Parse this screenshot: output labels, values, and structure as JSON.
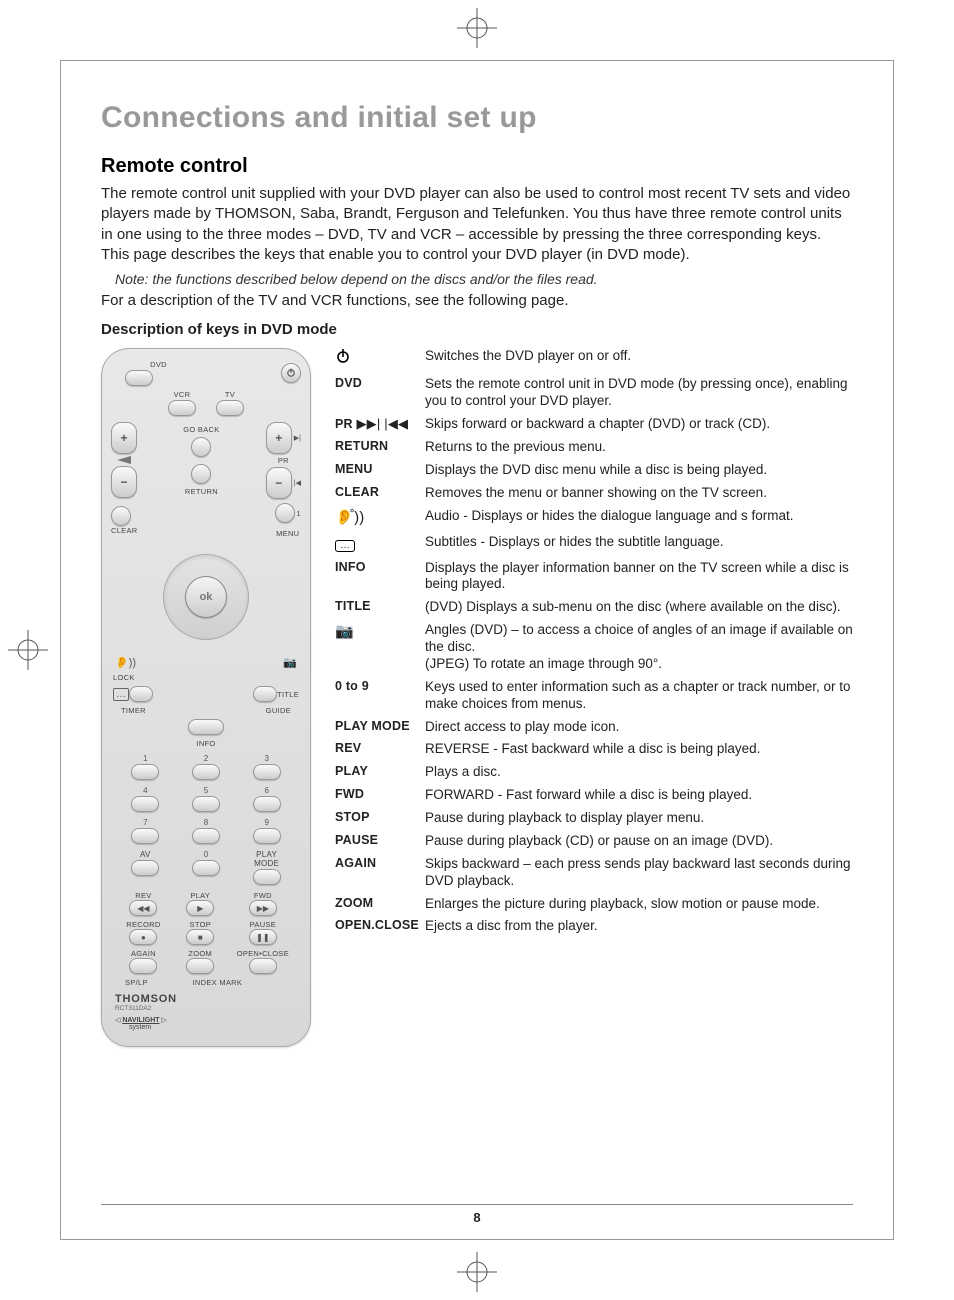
{
  "section_title": "Connections and initial set up",
  "subheading": "Remote control",
  "intro_paragraph": "The remote control unit supplied with your DVD player can also be used to control most recent TV sets and video players made by THOMSON, Saba, Brandt, Ferguson and Telefunken. You thus have three remote control units in one using to the three modes – DVD, TV and VCR – accessible by pressing the three corresponding keys. This page describes the keys that enable you to control your DVD player (in DVD mode).",
  "note": "Note: the functions described below depend on the discs and/or the files read.",
  "followup": "For a description of the TV and VCR functions, see the following page.",
  "desc_heading": "Description of keys in DVD mode",
  "page_number": "8",
  "remote": {
    "top_label_dvd": "DVD",
    "vcr": "VCR",
    "tv": "TV",
    "go_back": "GO BACK",
    "return": "RETURN",
    "pr": "PR",
    "clear": "CLEAR",
    "menu": "MENU",
    "ok": "ok",
    "digit1": "1",
    "lock": "LOCK",
    "title": "TITLE",
    "timer": "TIMER",
    "guide": "GUIDE",
    "info": "INFO",
    "av": "AV",
    "zero": "0",
    "play_mode": "PLAY MODE",
    "rev": "REV",
    "play": "PLAY",
    "fwd": "FWD",
    "record": "RECORD",
    "stop": "STOP",
    "pause": "PAUSE",
    "again": "AGAIN",
    "zoom": "ZOOM",
    "open_close": "OPEN•CLOSE",
    "sp_lp": "SP/LP",
    "index_mark": "INDEX MARK",
    "brand": "THOMSON",
    "model": "RCT311DA2",
    "navilight": "NAVILIGHT",
    "navisystem": "system"
  },
  "keys": [
    {
      "name_icon": "power",
      "desc": "Switches the DVD player on or off."
    },
    {
      "name": "DVD",
      "desc": "Sets the remote control unit in DVD mode (by pressing once), enabling you to control your DVD player."
    },
    {
      "name_compound": "PR ▶▶| |◀◀",
      "desc": "Skips forward or backward a chapter (DVD) or track (CD)."
    },
    {
      "name": "RETURN",
      "desc": "Returns to the previous menu."
    },
    {
      "name": "MENU",
      "desc": "Displays the DVD disc menu while a disc is being played."
    },
    {
      "name": "CLEAR",
      "desc": "Removes the menu or banner showing on the TV screen."
    },
    {
      "name_icon": "audio",
      "desc": "Audio - Displays or hides the dialogue language and s format."
    },
    {
      "name_icon": "subtitle",
      "desc": "Subtitles - Displays or hides the subtitle language."
    },
    {
      "name": "INFO",
      "desc": "Displays the player information banner on the TV screen while a disc is being played."
    },
    {
      "name": "TITLE",
      "desc": "(DVD) Displays a sub-menu on the disc (where available on the disc)."
    },
    {
      "name_icon": "angle",
      "desc": "Angles (DVD) – to access a choice of angles of an image if available on the disc.\n(JPEG) To rotate an image through 90°."
    },
    {
      "name": "0 to 9",
      "desc": "Keys used to enter information such as a chapter or track number, or to make choices from menus."
    },
    {
      "name": "PLAY MODE",
      "desc": "Direct access to play mode icon."
    },
    {
      "name": "REV",
      "desc": "REVERSE - Fast backward while a disc is being played."
    },
    {
      "name": "PLAY",
      "desc": "Plays a disc."
    },
    {
      "name": "FWD",
      "desc": "FORWARD - Fast forward while a disc is being played."
    },
    {
      "name": "STOP",
      "desc": "Pause during playback to display player menu."
    },
    {
      "name": "PAUSE",
      "desc": "Pause during playback (CD) or pause on an image (DVD)."
    },
    {
      "name": "AGAIN",
      "desc": "Skips backward – each press sends play backward last seconds during DVD playback."
    },
    {
      "name": "ZOOM",
      "desc": "Enlarges the picture during playback, slow motion or pause mode."
    },
    {
      "name": "OPEN.CLOSE",
      "desc": "Ejects a disc from the player."
    }
  ]
}
